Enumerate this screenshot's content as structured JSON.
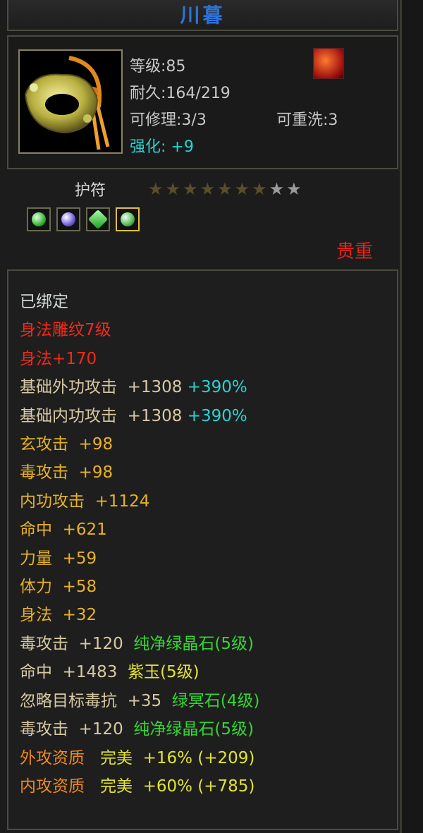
{
  "item": {
    "name": "川暮",
    "level": "等级:85",
    "durability": "耐久:164/219",
    "repairable": "可修理:3/3",
    "rewash": "可重洗:3",
    "enhance_label": "强化:",
    "enhance_value": "+9",
    "type": "护符",
    "stars_filled": 7,
    "stars_total": 9,
    "rarity": "贵重",
    "gems": [
      "green-gem-icon",
      "purple-gem-icon",
      "green-crystal-icon",
      "green-gem-icon"
    ]
  },
  "colors": {
    "title": "#2e72d6",
    "bound": "#d2d8d8",
    "red": "#f02a1a",
    "attribute": "#e7b227",
    "base_stat": "#d7c9a3",
    "cyan": "#27d4d4",
    "gem_green": "#34d634",
    "gem_yellow": "#e3e335",
    "quality": "#f08a1e"
  },
  "props": {
    "bound": "已绑定",
    "engraving": "身法雕纹7级",
    "engraving_bonus": "身法+170",
    "lines": [
      {
        "label": "基础外功攻击",
        "value": "+1308",
        "extra": "+390%"
      },
      {
        "label": "基础内功攻击",
        "value": "+1308",
        "extra": "+390%"
      },
      {
        "label": "玄攻击",
        "value": "+98"
      },
      {
        "label": "毒攻击",
        "value": "+98"
      },
      {
        "label": "内功攻击",
        "value": "+1124"
      },
      {
        "label": "命中",
        "value": "+621"
      },
      {
        "label": "力量",
        "value": "+59"
      },
      {
        "label": "体力",
        "value": "+58"
      },
      {
        "label": "身法",
        "value": "+32"
      },
      {
        "label": "毒攻击",
        "value": "+120",
        "gem": "纯净绿晶石(5级)"
      },
      {
        "label": "命中",
        "value": "+1483",
        "gem": "紫玉(5级)"
      },
      {
        "label": "忽略目标毒抗",
        "value": "+35",
        "gem": "绿冥石(4级)"
      },
      {
        "label": "毒攻击",
        "value": "+120",
        "gem": "纯净绿晶石(5级)"
      },
      {
        "label": "外攻资质",
        "quality": "完美",
        "value": "+16%",
        "extra": "(+209)"
      },
      {
        "label": "内攻资质",
        "quality": "完美",
        "value": "+60%",
        "extra": "(+785)"
      }
    ]
  }
}
